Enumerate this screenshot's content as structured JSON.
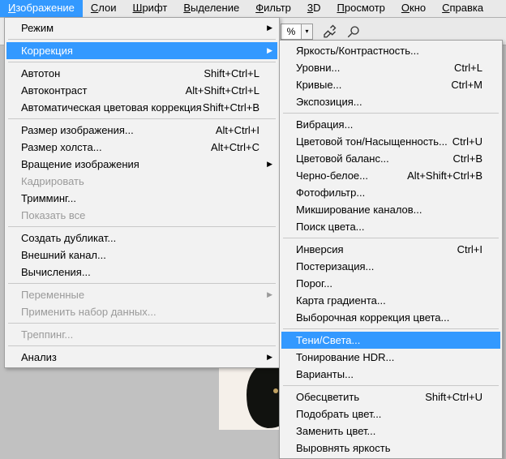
{
  "menubar": {
    "items": [
      {
        "label": "Изображение",
        "ul": "И"
      },
      {
        "label": "Слои",
        "ul": "С"
      },
      {
        "label": "Шрифт",
        "ul": "Ш"
      },
      {
        "label": "Выделение",
        "ul": "В"
      },
      {
        "label": "Фильтр",
        "ul": "Ф"
      },
      {
        "label": "3D",
        "ul": "3"
      },
      {
        "label": "Просмотр",
        "ul": "П"
      },
      {
        "label": "Окно",
        "ul": "О"
      },
      {
        "label": "Справка",
        "ul": "С"
      }
    ]
  },
  "toolbar": {
    "percent": "%"
  },
  "left_menu": {
    "g0": {
      "rezhim": "Режим"
    },
    "g0b": {
      "korr": "Коррекция"
    },
    "g1": {
      "autotone": {
        "l": "Автотон",
        "s": "Shift+Ctrl+L"
      },
      "autocontrast": {
        "l": "Автоконтраст",
        "s": "Alt+Shift+Ctrl+L"
      },
      "autocolor": {
        "l": "Автоматическая цветовая коррекция",
        "s": "Shift+Ctrl+B"
      }
    },
    "g2": {
      "imgsize": {
        "l": "Размер изображения...",
        "s": "Alt+Ctrl+I"
      },
      "canvas": {
        "l": "Размер холста...",
        "s": "Alt+Ctrl+C"
      },
      "rotate": {
        "l": "Вращение изображения"
      },
      "crop": {
        "l": "Кадрировать"
      },
      "trim": {
        "l": "Тримминг..."
      },
      "showall": {
        "l": "Показать все"
      }
    },
    "g3": {
      "dup": {
        "l": "Создать дубликат..."
      },
      "apply": {
        "l": "Внешний канал..."
      },
      "calc": {
        "l": "Вычисления..."
      }
    },
    "g4": {
      "vars": {
        "l": "Переменные"
      },
      "applyset": {
        "l": "Применить набор данных..."
      }
    },
    "g5": {
      "trap": {
        "l": "Треппинг..."
      }
    },
    "g6": {
      "analysis": {
        "l": "Анализ"
      }
    }
  },
  "right_menu": {
    "g0": {
      "bc": {
        "l": "Яркость/Контрастность..."
      },
      "levels": {
        "l": "Уровни...",
        "s": "Ctrl+L"
      },
      "curves": {
        "l": "Кривые...",
        "s": "Ctrl+M"
      },
      "expo": {
        "l": "Экспозиция..."
      }
    },
    "g1": {
      "vib": {
        "l": "Вибрация..."
      },
      "hue": {
        "l": "Цветовой тон/Насыщенность...",
        "s": "Ctrl+U"
      },
      "bal": {
        "l": "Цветовой баланс...",
        "s": "Ctrl+B"
      },
      "bw": {
        "l": "Черно-белое...",
        "s": "Alt+Shift+Ctrl+B"
      },
      "photo": {
        "l": "Фотофильтр..."
      },
      "mixer": {
        "l": "Микширование каналов..."
      },
      "lookup": {
        "l": "Поиск цвета..."
      }
    },
    "g2": {
      "inv": {
        "l": "Инверсия",
        "s": "Ctrl+I"
      },
      "post": {
        "l": "Постеризация..."
      },
      "thresh": {
        "l": "Порог..."
      },
      "gmap": {
        "l": "Карта градиента..."
      },
      "sel": {
        "l": "Выборочная коррекция цвета..."
      }
    },
    "g3": {
      "shadows": {
        "l": "Тени/Света..."
      },
      "hdr": {
        "l": "Тонирование HDR..."
      },
      "variants": {
        "l": "Варианты..."
      }
    },
    "g4": {
      "desat": {
        "l": "Обесцветить",
        "s": "Shift+Ctrl+U"
      },
      "match": {
        "l": "Подобрать цвет..."
      },
      "replace": {
        "l": "Заменить цвет..."
      },
      "equal": {
        "l": "Выровнять яркость"
      }
    }
  }
}
